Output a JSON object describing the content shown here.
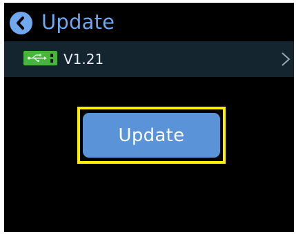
{
  "header": {
    "back_icon": "chevron-left-icon",
    "title": "Update"
  },
  "version_row": {
    "usb_icon": "usb-icon",
    "version": "V1.21",
    "arrow_icon": "chevron-right-icon"
  },
  "main": {
    "update_label": "Update"
  },
  "colors": {
    "background": "#000000",
    "accent": "#6fa8ee",
    "row_background": "#152530",
    "usb_green": "#45b53c",
    "button_blue": "#5b93d8",
    "highlight_yellow": "#ffef00"
  }
}
